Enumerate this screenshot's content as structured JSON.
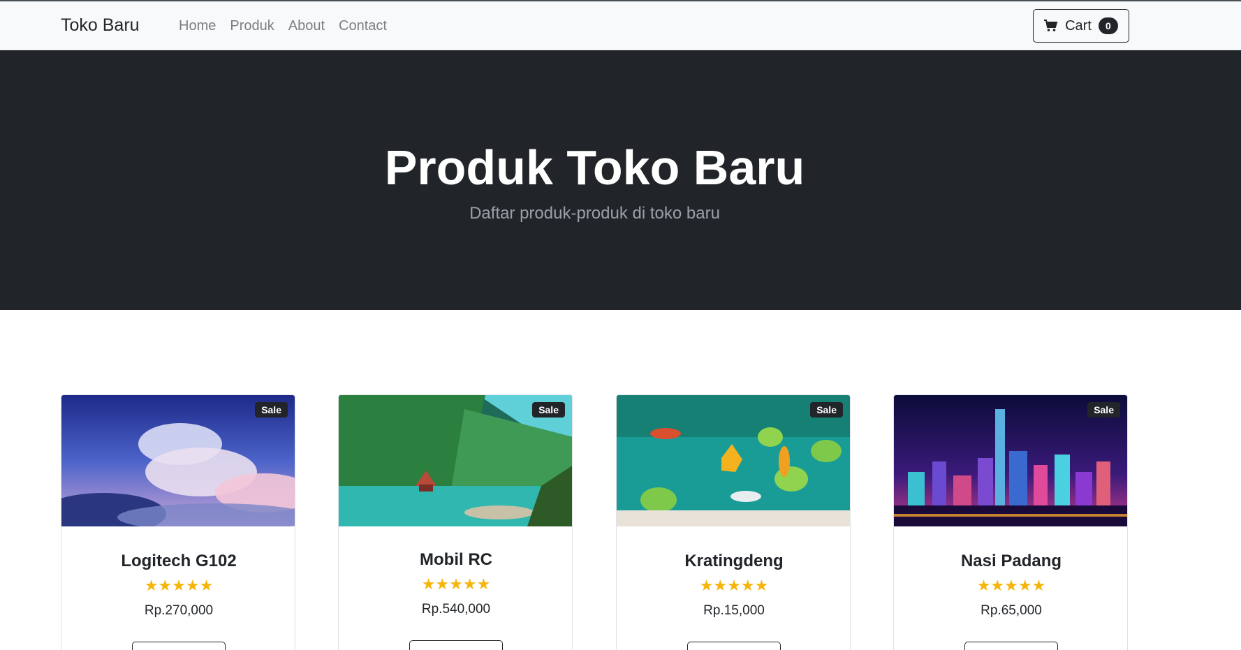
{
  "navbar": {
    "brand": "Toko Baru",
    "links": [
      "Home",
      "Produk",
      "About",
      "Contact"
    ],
    "cart": {
      "label": "Cart",
      "count": "0",
      "icon": "shopping-cart-icon"
    }
  },
  "hero": {
    "title": "Produk Toko Baru",
    "subtitle": "Daftar produk-produk di toko baru"
  },
  "products": [
    {
      "name": "Logitech G102",
      "price": "Rp.270,000",
      "badge": "Sale",
      "stars": "★★★★★",
      "image": "sky-clouds"
    },
    {
      "name": "Mobil RC",
      "price": "Rp.540,000",
      "badge": "Sale",
      "stars": "★★★★★",
      "image": "forest-lake"
    },
    {
      "name": "Kratingdeng",
      "price": "Rp.15,000",
      "badge": "Sale",
      "stars": "★★★★★",
      "image": "koi-pond"
    },
    {
      "name": "Nasi Padang",
      "price": "Rp.65,000",
      "badge": "Sale",
      "stars": "★★★★★",
      "image": "neon-city"
    }
  ],
  "colors": {
    "dark": "#212529",
    "navbar_bg": "#f8f9fa",
    "star": "#f5b50a",
    "nav_link": "#7a7f85"
  }
}
